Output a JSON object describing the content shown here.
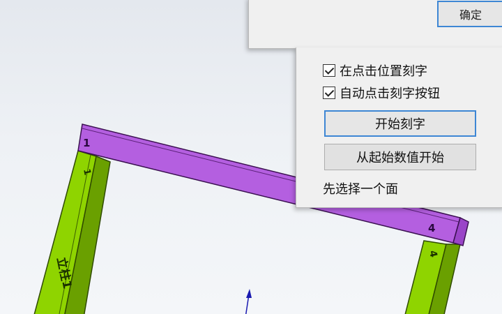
{
  "dialog": {
    "ok_label": "确定"
  },
  "panel": {
    "checkboxes": [
      {
        "label": "在点击位置刻字",
        "checked": true
      },
      {
        "label": "自动点击刻字按钮",
        "checked": true
      }
    ],
    "start_engrave_label": "开始刻字",
    "start_from_value_label": "从起始数值开始",
    "status": "先选择一个面"
  },
  "model": {
    "beam_number_left": "1",
    "beam_number_right": "4",
    "left_post_number": "1",
    "right_post_number": "4",
    "left_post_name": "立柱1",
    "colors": {
      "beam": "#b45fe0",
      "post": "#8fd400",
      "axis": "#1a1ab0"
    }
  }
}
